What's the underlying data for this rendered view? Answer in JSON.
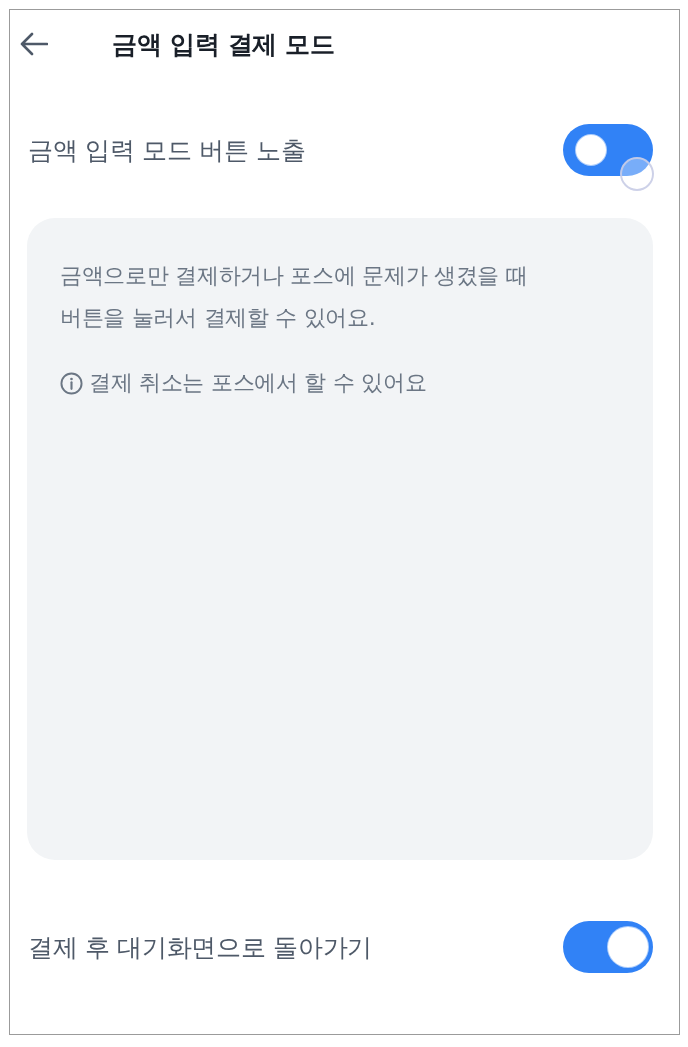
{
  "header": {
    "title": "금액 입력 결제 모드"
  },
  "settings": [
    {
      "label": "금액 입력 모드 버튼 노출",
      "on": true,
      "thumb_right": false,
      "pressed": true
    },
    {
      "label": "결제 후 대기화면으로 돌아가기",
      "on": true,
      "thumb_right": true,
      "pressed": false
    }
  ],
  "info_card": {
    "description": "금액으로만 결제하거나 포스에 문제가 생겼을 때\n버튼을 눌러서 결제할 수 있어요.",
    "note": "결제 취소는 포스에서 할 수 있어요"
  }
}
